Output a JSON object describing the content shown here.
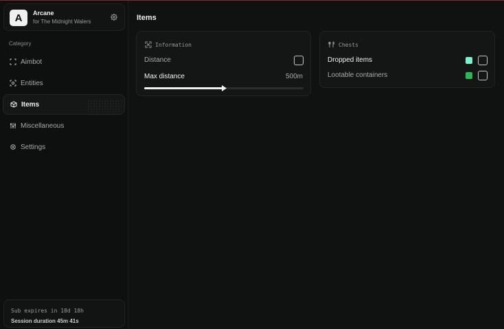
{
  "app": {
    "name": "Arcane",
    "logo_letter": "A",
    "subtitle": "for The Midnight Walers"
  },
  "sidebar": {
    "category_label": "Category",
    "items": [
      {
        "label": "Aimbot",
        "icon": "crosshair-square-icon",
        "active": false
      },
      {
        "label": "Entities",
        "icon": "scan-target-icon",
        "active": false
      },
      {
        "label": "Items",
        "icon": "cube-icon",
        "active": true
      },
      {
        "label": "Miscellaneous",
        "icon": "settings-grid-icon",
        "active": false
      },
      {
        "label": "Settings",
        "icon": "gear-icon",
        "active": false
      }
    ],
    "subscription": "Sub expires in 18d 18h",
    "session": "Session duration 45m 41s"
  },
  "main": {
    "title": "Items",
    "information": {
      "title": "Information",
      "distance_label": "Distance",
      "distance_checked": false,
      "max_distance_label": "Max distance",
      "max_distance_value": "500m",
      "max_distance_fraction": 0.5
    },
    "chests": {
      "title": "Chests",
      "items": [
        {
          "label": "Dropped items",
          "color": "#7ef0d0",
          "checked": false
        },
        {
          "label": "Lootable containers",
          "color": "#2fb45a",
          "checked": false
        }
      ]
    }
  }
}
